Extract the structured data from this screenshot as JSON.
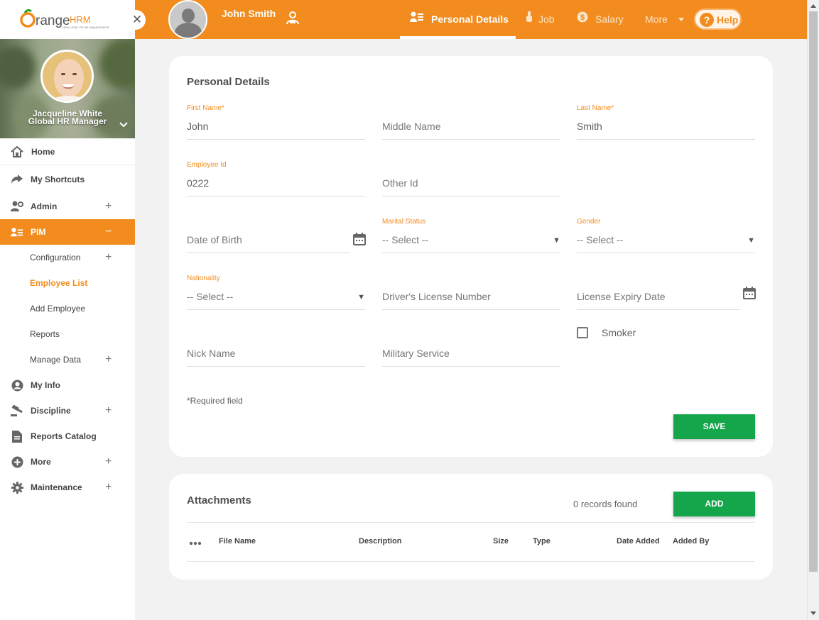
{
  "brand": {
    "logo_main": "Orange",
    "logo_suffix": "HRM",
    "tagline": "NEW LEVEL OF HR MANAGEMENT"
  },
  "sidebar": {
    "close_glyph": "✕",
    "profile": {
      "name": "Jacqueline White",
      "role": "Global HR Manager"
    },
    "items": [
      {
        "label": "Home",
        "icon": "home-icon"
      },
      {
        "label": "My Shortcuts",
        "icon": "share-arrow-icon"
      },
      {
        "label": "Admin",
        "icon": "user-cog-icon",
        "expand": "+"
      },
      {
        "label": "PIM",
        "icon": "id-card-icon",
        "expand": "−",
        "active": true
      },
      {
        "label": "My Info",
        "icon": "user-circle-icon"
      },
      {
        "label": "Discipline",
        "icon": "gavel-icon",
        "expand": "+"
      },
      {
        "label": "Reports Catalog",
        "icon": "file-icon"
      },
      {
        "label": "More",
        "icon": "plus-circle-icon",
        "expand": "+"
      },
      {
        "label": "Maintenance",
        "icon": "gear-icon",
        "expand": "+"
      }
    ],
    "pim_sub": [
      {
        "label": "Configuration",
        "expand": "+"
      },
      {
        "label": "Employee List",
        "current": true
      },
      {
        "label": "Add Employee"
      },
      {
        "label": "Reports"
      },
      {
        "label": "Manage Data",
        "expand": "+"
      }
    ]
  },
  "header": {
    "employee_name": "John Smith",
    "tabs": [
      {
        "label": "Personal Details",
        "icon": "id-card-icon",
        "active": true
      },
      {
        "label": "Job",
        "icon": "flask-icon"
      },
      {
        "label": "Salary",
        "icon": "dollar-coin-icon"
      },
      {
        "label": "More",
        "icon": "chevron-down-icon"
      }
    ],
    "help_glyph": "?",
    "help_label": "Help"
  },
  "personal_details": {
    "title": "Personal Details",
    "first_name": {
      "label": "First Name",
      "value": "John"
    },
    "middle_name": {
      "placeholder": "Middle Name"
    },
    "last_name": {
      "label": "Last Name",
      "value": "Smith"
    },
    "employee_id": {
      "label": "Employee Id",
      "value": "0222"
    },
    "other_id": {
      "placeholder": "Other Id"
    },
    "date_of_birth": {
      "placeholder": "Date of Birth"
    },
    "marital_status": {
      "label": "Marital Status",
      "value": "-- Select --"
    },
    "gender": {
      "label": "Gender",
      "value": "-- Select --"
    },
    "nationality": {
      "label": "Nationality",
      "value": "-- Select --"
    },
    "drivers_license": {
      "placeholder": "Driver's License Number"
    },
    "license_expiry": {
      "placeholder": "License Expiry Date"
    },
    "smoker": {
      "label": "Smoker",
      "checked": false
    },
    "nick_name": {
      "placeholder": "Nick Name"
    },
    "military_service": {
      "placeholder": "Military Service"
    },
    "required_asterisk": "*",
    "required_note": "Required field",
    "save_label": "SAVE"
  },
  "attachments": {
    "title": "Attachments",
    "records": "0 records found",
    "add_label": "ADD",
    "columns": [
      "File Name",
      "Description",
      "Size",
      "Type",
      "Date Added",
      "Added By"
    ]
  },
  "colors": {
    "brand_orange": "#f28c1e",
    "save_green": "#15a54a",
    "background": "#f2f2f2"
  }
}
